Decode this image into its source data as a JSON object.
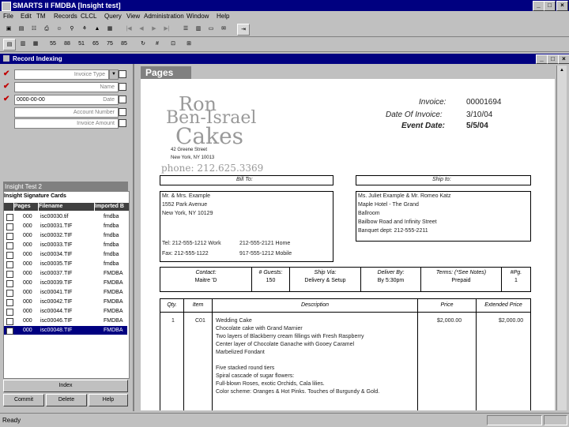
{
  "app": {
    "title": "SMARTS II FMDBA [Insight test]"
  },
  "menu": [
    "File",
    "Edit",
    "TM",
    "Records",
    "CLCL",
    "Query",
    "View",
    "Administration",
    "Window",
    "Help"
  ],
  "toolbar2": [
    "55",
    "88",
    "51",
    "65",
    "75",
    "85"
  ],
  "child": {
    "title": "Record Indexing"
  },
  "fields": [
    {
      "label": "Invoice Type",
      "value": "",
      "checked": true
    },
    {
      "label": "Name",
      "value": "",
      "checked": true
    },
    {
      "label": "Date",
      "value": "0000-00-00",
      "checked": true
    },
    {
      "label": "Account Number",
      "value": "",
      "checked": false
    },
    {
      "label": "Invoice Amount",
      "value": "",
      "checked": false
    }
  ],
  "grid": {
    "title": "Insight Test 2",
    "subtitle": "Insight Signature Cards",
    "headers": [
      "Pages",
      "Filename",
      "Imported B"
    ],
    "rows": [
      {
        "pages": "000",
        "file": "isc00030.tif",
        "by": "fmdba"
      },
      {
        "pages": "000",
        "file": "isc00031.TIF",
        "by": "fmdba"
      },
      {
        "pages": "000",
        "file": "isc00032.TIF",
        "by": "fmdba"
      },
      {
        "pages": "000",
        "file": "isc00033.TIF",
        "by": "fmdba"
      },
      {
        "pages": "000",
        "file": "isc00034.TIF",
        "by": "fmdba"
      },
      {
        "pages": "000",
        "file": "isc00035.TIF",
        "by": "fmdba"
      },
      {
        "pages": "000",
        "file": "isc00037.TIF",
        "by": "FMDBA"
      },
      {
        "pages": "000",
        "file": "isc00039.TIF",
        "by": "FMDBA"
      },
      {
        "pages": "000",
        "file": "isc00041.TIF",
        "by": "FMDBA"
      },
      {
        "pages": "000",
        "file": "isc00042.TIF",
        "by": "FMDBA"
      },
      {
        "pages": "000",
        "file": "isc00044.TIF",
        "by": "FMDBA"
      },
      {
        "pages": "000",
        "file": "isc00046.TIF",
        "by": "FMDBA"
      },
      {
        "pages": "000",
        "file": "isc00048.TIF",
        "by": "FMDBA"
      }
    ]
  },
  "buttons": {
    "index": "Index",
    "commit": "Commit",
    "delete": "Delete",
    "help": "Help"
  },
  "pages_label": "Pages",
  "invoice": {
    "logo1": "Ron",
    "logo2": "Ben-Israel",
    "logo3": "Cakes",
    "addr1": "42 Greene Street",
    "addr2": "New York, NY 10013",
    "phone": "phone: 212.625.3369",
    "invoice_label": "Invoice:",
    "invoice_no": "00001694",
    "date_label": "Date Of Invoice:",
    "date": "3/10/04",
    "event_label": "Event Date:",
    "event": "5/5/04",
    "bill_to": "Bill To:",
    "ship_to": "Ship to:",
    "bill_lines": [
      "Mr. & Mrs. Example",
      "1552 Park Avenue",
      "New York, NY 10129"
    ],
    "bill_tel": "Tel: 212-555-1212 Work",
    "bill_home": "212-555-2121 Home",
    "bill_fax": "Fax: 212-555-1122",
    "bill_mobile": "917-555-1212 Mobile",
    "ship_lines": [
      "Ms. Juliet Example & Mr. Romeo Katz",
      "Maple Hotel - The Grand",
      "Ballroom",
      "Bailbow Road and Infinity Street",
      "Banquet dept: 212-555-2211"
    ],
    "meta_headers": [
      "Contact:",
      "# Guests:",
      "Ship Via:",
      "Deliver By:",
      "Terms: (*See Notes)",
      "#Pg."
    ],
    "meta_values": [
      "Maitre 'D",
      "150",
      "Delivery & Setup",
      "By 5:30pm",
      "Prepaid",
      "1"
    ],
    "items_headers": [
      "Qty.",
      "Item",
      "Description",
      "Price",
      "Extended Price"
    ],
    "item": {
      "qty": "1",
      "code": "C01",
      "price": "$2,000.00",
      "ext": "$2,000.00"
    },
    "desc": [
      "Wedding Cake",
      "Chocolate cake with Grand Marnier",
      "Two layers of Blackberry cream fillings with Fresh Raspberry",
      "Center layer of Chocolate Ganache with Gooey Caramel",
      "Marbelized Fondant",
      "",
      "Five stacked round tiers",
      "Spiral cascade of sugar flowers:",
      "Full-blown Roses, exotic Orchids, Cala lilies.",
      "Color scheme: Oranges & Hot Pinks. Touches of Burgundy & Gold."
    ]
  },
  "status": {
    "text": "Ready"
  }
}
